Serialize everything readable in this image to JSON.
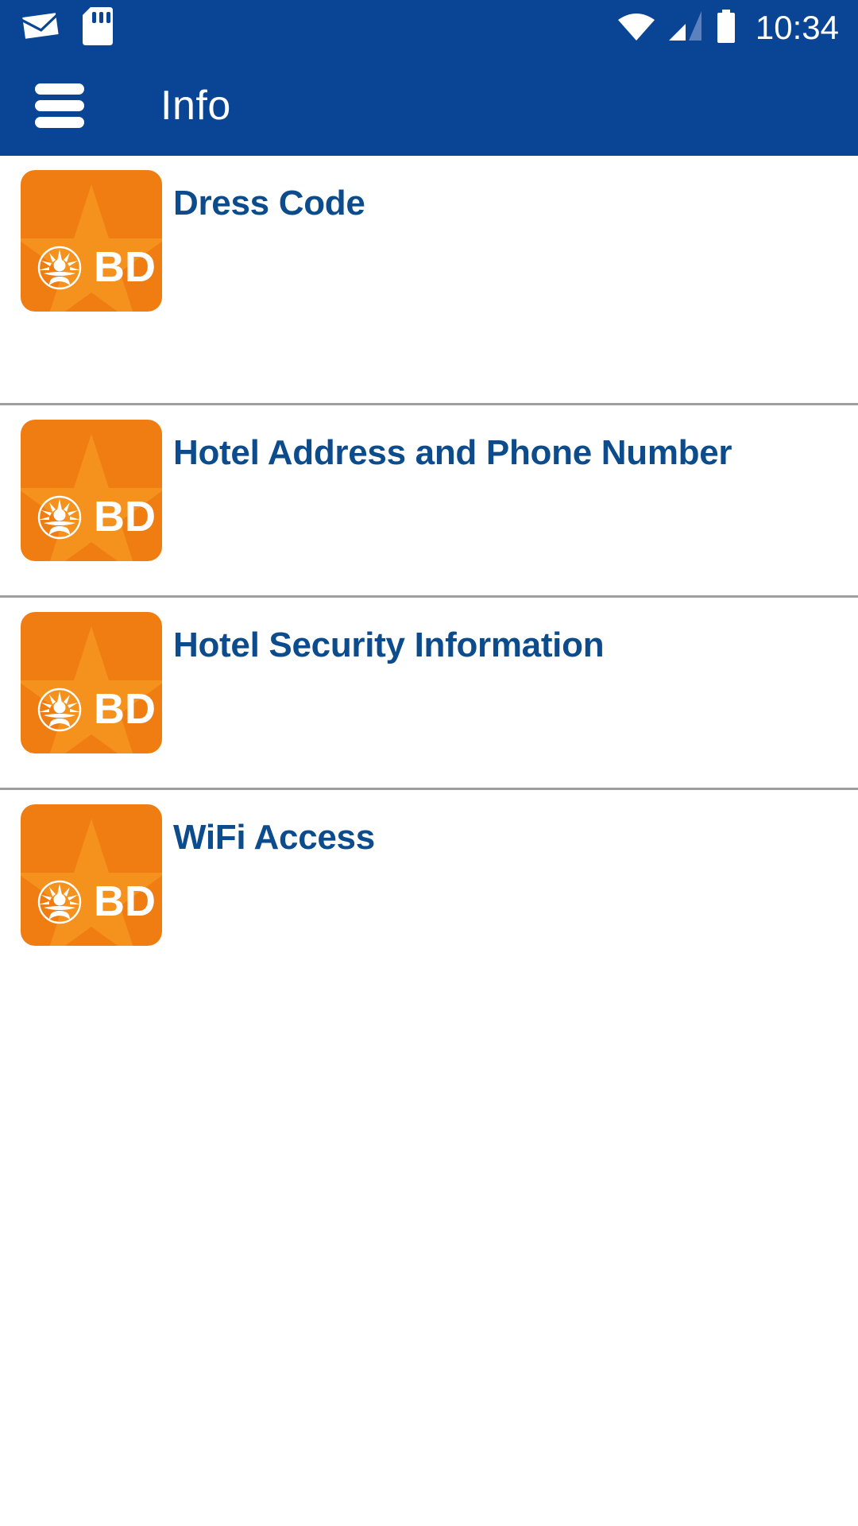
{
  "theme": {
    "brand_blue": "#0A4595",
    "title_blue": "#0D4C8C",
    "tile_orange": "#F07D12",
    "star_orange": "#F5921E",
    "divider_gray": "#9E9E9E",
    "background": "#FFFFFF"
  },
  "status_bar": {
    "time": "10:34",
    "icons_left": [
      "mail-icon",
      "sd-card-icon"
    ],
    "icons_right": [
      "wifi-icon",
      "cell-signal-icon",
      "battery-icon"
    ]
  },
  "app_bar": {
    "menu_icon": "hamburger-menu-icon",
    "title": "Info"
  },
  "list": {
    "items": [
      {
        "title": "Dress Code",
        "icon": "bd-logo-icon",
        "icon_text": "BD"
      },
      {
        "title": "Hotel Address and Phone Number",
        "icon": "bd-logo-icon",
        "icon_text": "BD"
      },
      {
        "title": "Hotel Security Information",
        "icon": "bd-logo-icon",
        "icon_text": "BD"
      },
      {
        "title": "WiFi Access",
        "icon": "bd-logo-icon",
        "icon_text": "BD"
      }
    ]
  }
}
